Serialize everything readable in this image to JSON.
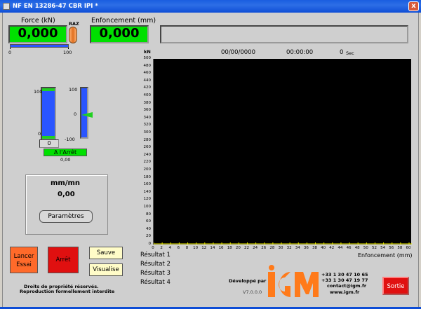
{
  "window": {
    "title": "NF EN 13286-47 CBR IPI *",
    "close_glyph": "x"
  },
  "force": {
    "label": "Force (kN)",
    "value": "0,000",
    "raz_label": "RAZ",
    "slider_min": "0",
    "slider_max": "100"
  },
  "enfoncement": {
    "label": "Enfoncement (mm)",
    "value": "0,000"
  },
  "status_bar": {
    "date": "00/00/0000",
    "time": "00:00:00",
    "seconds": "0",
    "seconds_unit": "Sec"
  },
  "gauge_left": {
    "top": "100",
    "bottom": "0",
    "value": "0"
  },
  "gauge_right": {
    "top": "100",
    "mid": "0",
    "bottom": "-100"
  },
  "state": {
    "label": "A l'Arrêt",
    "value": "0,00"
  },
  "speed": {
    "unit": "mm/mn",
    "value": "0,00",
    "params_button": "Paramètres"
  },
  "buttons": {
    "lancer": "Lancer\nEssai",
    "arret": "Arrêt",
    "sauve": "Sauve",
    "visualise": "Visualise",
    "sortie": "Sortie"
  },
  "copyright": {
    "line1": "Droits de propriété réservés.",
    "line2": "Reproduction formellement interdite"
  },
  "results": [
    "Résultat 1",
    "Résultat 2",
    "Résultat 3",
    "Résultat 4"
  ],
  "footer": {
    "developed_by": "Développé par",
    "version": "V7.0.0.0",
    "phone1": "+33 1 30 47 10 65",
    "phone2": "+33 1 30 47 19 77",
    "email": "contact@igm.fr",
    "website": "www.igm.fr",
    "logo_text": "IGM"
  },
  "colors": {
    "display_green": "#00e000",
    "stop_red": "#e01010",
    "start_orange": "#ff6a2a",
    "cream": "#fffcc8",
    "plot_bg": "#000000",
    "axis_yellow": "#e8e800"
  },
  "chart_data": {
    "type": "line",
    "title": "",
    "ylabel": "kN",
    "xlabel": "Enfoncement (mm)",
    "ylim": [
      0,
      500
    ],
    "xlim": [
      0,
      60
    ],
    "yticks": [
      0,
      20,
      40,
      60,
      80,
      100,
      120,
      140,
      160,
      180,
      200,
      220,
      240,
      260,
      280,
      300,
      320,
      340,
      360,
      380,
      400,
      420,
      440,
      460,
      480,
      500
    ],
    "xticks": [
      0,
      2,
      4,
      6,
      8,
      10,
      12,
      14,
      16,
      18,
      20,
      22,
      24,
      26,
      28,
      30,
      32,
      34,
      36,
      38,
      40,
      42,
      44,
      46,
      48,
      50,
      52,
      54,
      56,
      58,
      60
    ],
    "series": []
  }
}
